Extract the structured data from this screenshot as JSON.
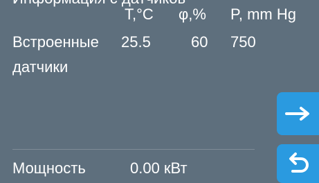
{
  "header": {
    "title": "Информация с датчиков"
  },
  "table": {
    "columns": [
      "T,°C",
      "φ,%",
      "P, mm Hg"
    ],
    "rows": [
      {
        "label_line1": "Встроенные",
        "label_line2": "датчики",
        "temperature": "25.5",
        "humidity": "60",
        "pressure": "750"
      }
    ]
  },
  "power": {
    "label": "Мощность",
    "value": "0.00 кВт"
  },
  "buttons": {
    "next_icon": "arrow-right-icon",
    "back_icon": "return-arrow-icon"
  },
  "colors": {
    "background": "#5e6f7d",
    "accent": "#2a9ae0",
    "text": "#ffffff"
  }
}
